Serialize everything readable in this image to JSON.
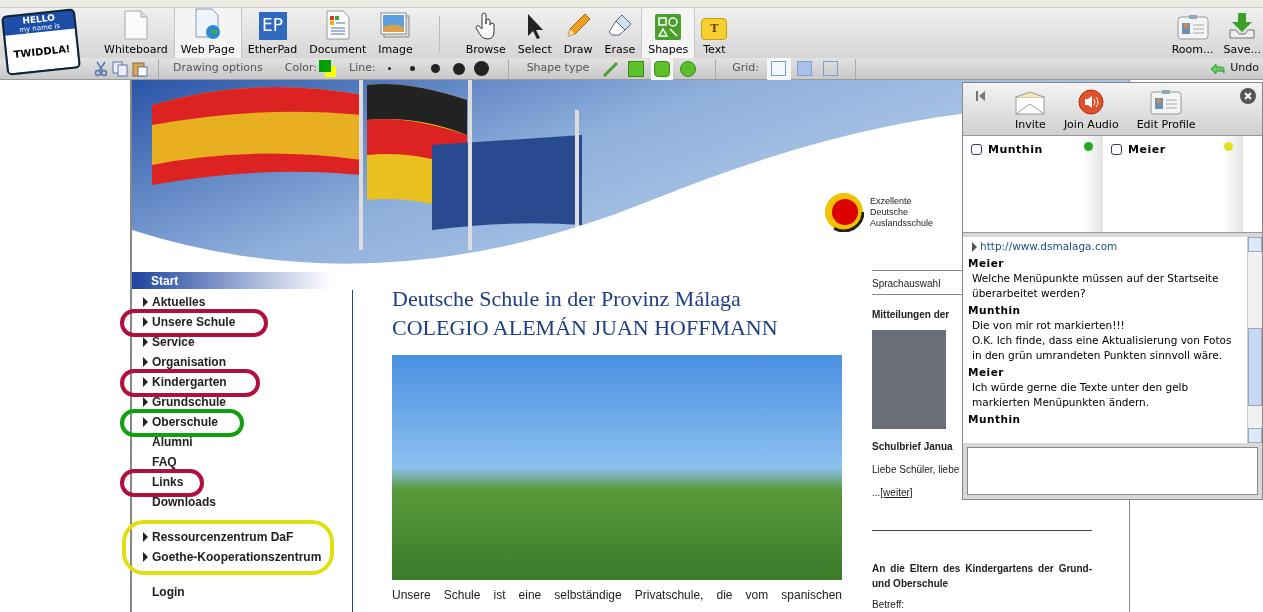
{
  "logo": {
    "hello": "HELLO",
    "subtitle": "my name is",
    "name": "TWIDDLA!"
  },
  "toolbar": {
    "modes": [
      {
        "label": "Whiteboard",
        "selected": false
      },
      {
        "label": "Web Page",
        "selected": true
      },
      {
        "label": "EtherPad",
        "icon_text": "EP",
        "selected": false
      },
      {
        "label": "Document",
        "selected": false
      },
      {
        "label": "Image",
        "selected": false
      }
    ],
    "tools": [
      {
        "label": "Browse",
        "selected": false
      },
      {
        "label": "Select",
        "selected": false
      },
      {
        "label": "Draw",
        "selected": false
      },
      {
        "label": "Erase",
        "selected": false
      },
      {
        "label": "Shapes",
        "selected": true
      },
      {
        "label": "Text",
        "icon_text": "T",
        "selected": false
      }
    ],
    "right": [
      {
        "label": "Room..."
      },
      {
        "label": "Save..."
      }
    ]
  },
  "options": {
    "drawing_label": "Drawing options",
    "color_label": "Color:",
    "swatches": [
      {
        "color": "#00a000"
      },
      {
        "color": "#ffff00"
      }
    ],
    "line_label": "Line:",
    "line_sizes": [
      {
        "selected": false
      },
      {
        "selected": false
      },
      {
        "selected": false
      },
      {
        "selected": false
      },
      {
        "selected": false
      }
    ],
    "shape_label": "Shape type",
    "shapes": [
      {
        "kind": "line",
        "selected": false
      },
      {
        "kind": "square",
        "selected": false
      },
      {
        "kind": "rounded",
        "selected": true
      },
      {
        "kind": "circle",
        "selected": false
      }
    ],
    "grid_label": "Grid:",
    "grids": [
      {
        "kind": "none",
        "selected": true
      },
      {
        "kind": "dots",
        "selected": false
      },
      {
        "kind": "lines",
        "selected": false
      }
    ],
    "undo": "Undo"
  },
  "page": {
    "banner_logo": [
      "Exzellente",
      "Deutsche",
      "Auslandsschule"
    ],
    "nav": {
      "start": "Start",
      "sections": [
        {
          "items": [
            {
              "label": "Aktuelles",
              "arrow": true
            },
            {
              "label": "Unsere Schule",
              "arrow": true,
              "color": "#b0103c"
            },
            {
              "label": "Service",
              "arrow": true
            },
            {
              "label": "Organisation",
              "arrow": true
            },
            {
              "label": "Kindergarten",
              "arrow": true,
              "color": "#b0103c"
            },
            {
              "label": "Grundschule",
              "arrow": true
            },
            {
              "label": "Oberschule",
              "arrow": true,
              "color": "#10a010"
            },
            {
              "label": "Alumni",
              "arrow": false
            },
            {
              "label": "FAQ",
              "arrow": false
            },
            {
              "label": "Links",
              "arrow": false,
              "color": "#b0103c"
            },
            {
              "label": "Downloads",
              "arrow": false
            }
          ]
        },
        {
          "items": [
            {
              "label": "Ressourcenzentrum DaF",
              "arrow": true
            },
            {
              "label": "Goethe-Kooperationszentrum",
              "arrow": true
            }
          ],
          "color": "#e0e010"
        },
        {
          "items": [
            {
              "label": "Login",
              "arrow": false
            }
          ]
        }
      ]
    },
    "title": [
      "Deutsche Schule in der Provinz Málaga",
      "COLEGIO ALEMÁN JUAN HOFFMANN"
    ],
    "intro": "Unsere Schule ist eine selbständige Privatschule, die vom spanischen",
    "aside": {
      "language": "Sprachauswahl",
      "news_heading": "Mitteilungen der",
      "news_title": "Schulbrief Janua",
      "news_text": "Liebe Schüler, liebe",
      "more_prefix": "...",
      "more_link": "[weiter]",
      "notice_heading": "An die Eltern des Kindergartens der Grund- und Oberschule",
      "subject": "Betreff:"
    }
  },
  "chat": {
    "actions": [
      {
        "label": "Invite"
      },
      {
        "label": "Join Audio"
      },
      {
        "label": "Edit Profile"
      }
    ],
    "users": [
      {
        "name": "Munthin",
        "checked": false,
        "color": "#22aa22"
      },
      {
        "name": "Meier",
        "checked": false,
        "color": "#e0e020"
      }
    ],
    "link": "http://www.dsmalaga.com",
    "messages": [
      {
        "author": "Meier",
        "lines": [
          "Welche Menüpunkte müssen auf der Startseite überarbeitet werden?"
        ]
      },
      {
        "author": "Munthin",
        "lines": [
          "Die von mir rot markierten!!!",
          "O.K. Ich finde, dass eine Aktualisierung von Fotos in den grün umrandeten Punkten sinnvoll wäre."
        ]
      },
      {
        "author": "Meier",
        "lines": [
          "Ich würde gerne die Texte unter den gelb markierten Menüpunkten ändern."
        ]
      },
      {
        "author": "Munthin"
      }
    ]
  }
}
